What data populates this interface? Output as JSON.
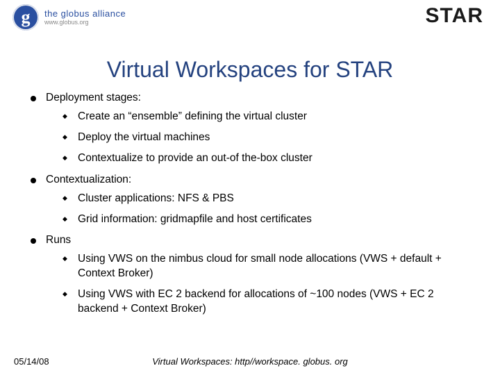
{
  "header": {
    "globus_g": "g",
    "globus_name": "the globus alliance",
    "globus_url": "www.globus.org",
    "star_text": "STAR"
  },
  "title": "Virtual Workspaces for STAR",
  "bullets": [
    {
      "label": "Deployment stages:",
      "sub": [
        "Create an “ensemble” defining the virtual cluster",
        "Deploy the virtual machines",
        "Contextualize to provide an out-of the-box cluster"
      ]
    },
    {
      "label": "Contextualization:",
      "sub": [
        "Cluster applications: NFS & PBS",
        "Grid information: gridmapfile and host certificates"
      ]
    },
    {
      "label": "Runs",
      "sub": [
        "Using VWS on the nimbus cloud for small node allocations (VWS + default + Context Broker)",
        "Using VWS with EC 2 backend for allocations of ~100 nodes (VWS + EC 2 backend + Context Broker)"
      ]
    }
  ],
  "footer": {
    "date": "05/14/08",
    "center": "Virtual Workspaces: http//workspace. globus. org"
  },
  "colors": {
    "title": "#24427f",
    "rule": "#6a8dcf",
    "globus": "#2a4fa0",
    "star": "#c33043"
  }
}
